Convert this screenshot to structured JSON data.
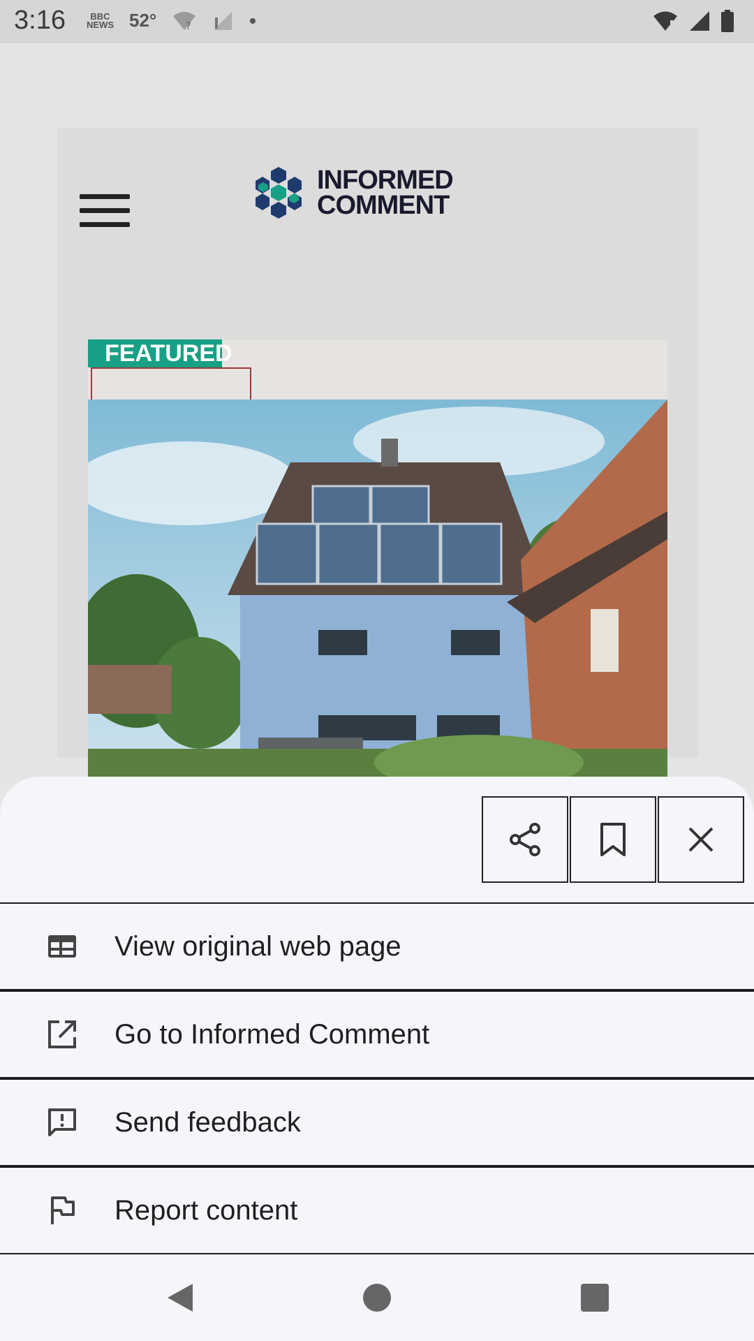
{
  "status_bar": {
    "time": "3:16",
    "bbc_line1": "BBC",
    "bbc_line2": "NEWS",
    "temperature": "52°"
  },
  "site": {
    "logo_line1": "INFORMED",
    "logo_line2": "COMMENT",
    "featured_label": "FEATURED"
  },
  "sheet": {
    "share_icon": "share-icon",
    "bookmark_icon": "bookmark-icon",
    "close_icon": "close-icon",
    "items": [
      {
        "label": "View original web page",
        "icon": "web-page-icon"
      },
      {
        "label": "Go to Informed Comment",
        "icon": "open-external-icon"
      },
      {
        "label": "Send feedback",
        "icon": "feedback-icon"
      },
      {
        "label": "Report content",
        "icon": "flag-icon"
      }
    ]
  },
  "colors": {
    "accent": "#17a085",
    "sheet_bg": "#f5f6fa"
  }
}
